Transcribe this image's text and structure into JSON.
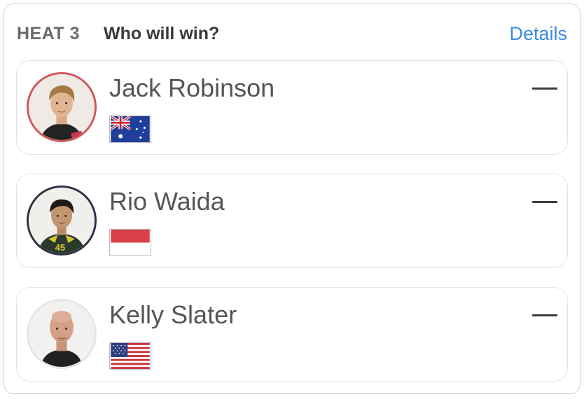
{
  "header": {
    "heat_label": "HEAT 3",
    "question": "Who will win?",
    "details_label": "Details"
  },
  "surfers": [
    {
      "name": "Jack Robinson",
      "country_flag": "australia-flag",
      "ring_color": "#d0575a",
      "pick_indicator": "—"
    },
    {
      "name": "Rio Waida",
      "country_flag": "indonesia-flag",
      "ring_color": "#2c3145",
      "pick_indicator": "—"
    },
    {
      "name": "Kelly Slater",
      "country_flag": "usa-flag",
      "ring_color": "#e6e6e6",
      "pick_indicator": "—"
    }
  ],
  "colors": {
    "accent": "#3c8be0",
    "text_primary": "#555558",
    "text_header": "#3a3a3c"
  }
}
